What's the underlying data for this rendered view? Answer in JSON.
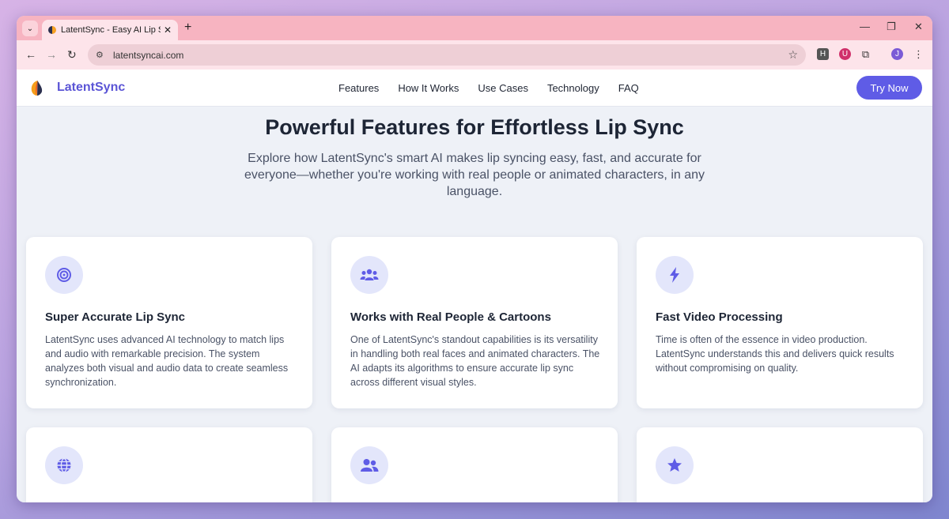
{
  "browser": {
    "tab_title": "LatentSync - Easy AI Lip Sync fo",
    "url": "latentsyncai.com",
    "profile_initial": "J",
    "ext_h_label": "H"
  },
  "site": {
    "brand": "LatentSync",
    "nav": [
      "Features",
      "How It Works",
      "Use Cases",
      "Technology",
      "FAQ"
    ],
    "cta": "Try Now",
    "accent": "#5f5ce6"
  },
  "hero": {
    "title": "Powerful Features for Effortless Lip Sync",
    "subtitle": "Explore how LatentSync's smart AI makes lip syncing easy, fast, and accurate for everyone—whether you're working with real people or animated characters, in any language."
  },
  "features": [
    {
      "icon": "target-icon",
      "title": "Super Accurate Lip Sync",
      "text": "LatentSync uses advanced AI technology to match lips and audio with remarkable precision. The system analyzes both visual and audio data to create seamless synchronization."
    },
    {
      "icon": "people-group-icon",
      "title": "Works with Real People & Cartoons",
      "text": "One of LatentSync's standout capabilities is its versatility in handling both real faces and animated characters. The AI adapts its algorithms to ensure accurate lip sync across different visual styles."
    },
    {
      "icon": "lightning-icon",
      "title": "Fast Video Processing",
      "text": "Time is often of the essence in video production. LatentSync understands this and delivers quick results without compromising on quality."
    },
    {
      "icon": "globe-icon"
    },
    {
      "icon": "users-icon"
    },
    {
      "icon": "star-icon"
    }
  ]
}
